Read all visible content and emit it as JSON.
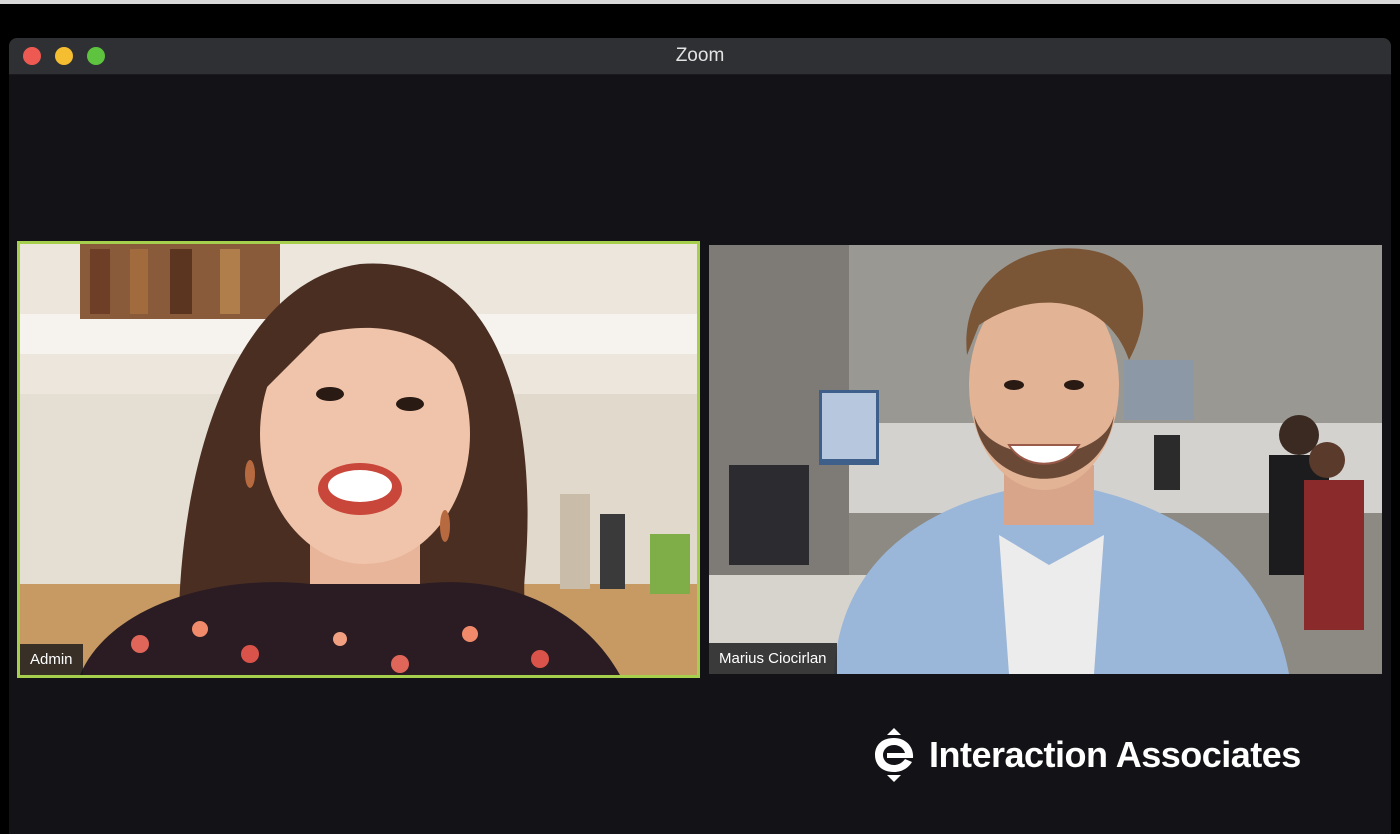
{
  "window": {
    "title": "Zoom",
    "controls": [
      "close",
      "minimize",
      "zoom"
    ]
  },
  "participants": [
    {
      "name": "Admin",
      "active_speaker": true
    },
    {
      "name": "Marius Ciocirlan",
      "active_speaker": false
    }
  ],
  "branding": {
    "text": "Interaction Associates"
  },
  "colors": {
    "active_speaker_border": "#a5cf4d",
    "close": "#ee5a52",
    "minimize": "#f5be31",
    "zoom": "#5ec43f",
    "titlebar": "#2f3033",
    "background": "#131317"
  }
}
